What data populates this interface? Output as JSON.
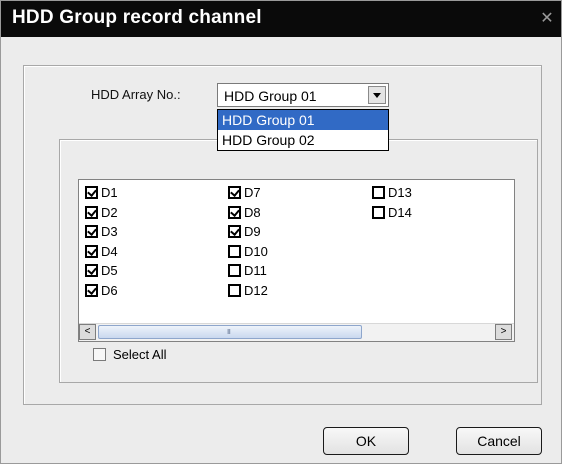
{
  "dialog": {
    "title": "HDD Group record channel",
    "close_glyph": "✕"
  },
  "hdd_array": {
    "label": "HDD Array No.:",
    "selected": "HDD Group 01",
    "options": [
      "HDD Group 01",
      "HDD Group 02"
    ]
  },
  "channels": {
    "columns": [
      [
        {
          "label": "D1",
          "checked": true
        },
        {
          "label": "D2",
          "checked": true
        },
        {
          "label": "D3",
          "checked": true
        },
        {
          "label": "D4",
          "checked": true
        },
        {
          "label": "D5",
          "checked": true
        },
        {
          "label": "D6",
          "checked": true
        }
      ],
      [
        {
          "label": "D7",
          "checked": true
        },
        {
          "label": "D8",
          "checked": true
        },
        {
          "label": "D9",
          "checked": true
        },
        {
          "label": "D10",
          "checked": false
        },
        {
          "label": "D11",
          "checked": false
        },
        {
          "label": "D12",
          "checked": false
        }
      ],
      [
        {
          "label": "D13",
          "checked": false
        },
        {
          "label": "D14",
          "checked": false
        }
      ]
    ]
  },
  "scrollbar": {
    "left_arrow": "<",
    "right_arrow": ">",
    "grip": "III"
  },
  "select_all": {
    "label": "Select All",
    "checked": false
  },
  "buttons": {
    "ok": "OK",
    "cancel": "Cancel"
  }
}
